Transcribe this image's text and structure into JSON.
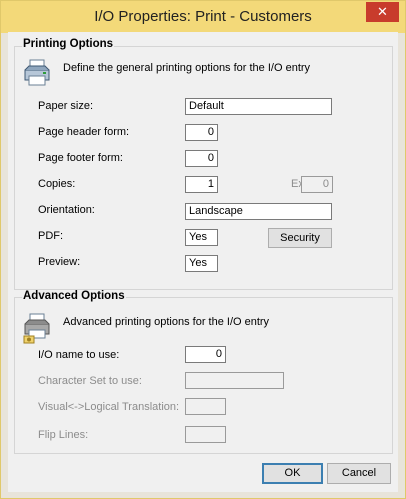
{
  "window": {
    "title": "I/O Properties: Print - Customers",
    "close_glyph": "✕",
    "colors": {
      "titlebar": "#f3d979",
      "close": "#c83c2c"
    }
  },
  "printing_options": {
    "title": "Printing Options",
    "description": "Define the general printing options for the I/O entry",
    "icon": "printer-icon",
    "paper_size": {
      "label": "Paper size:",
      "value": "Default"
    },
    "page_header_form": {
      "label": "Page header form:",
      "value": "0"
    },
    "page_footer_form": {
      "label": "Page footer form:",
      "value": "0"
    },
    "copies": {
      "label": "Copies:",
      "value": "1"
    },
    "exp": {
      "label": "Exp :",
      "value": "0"
    },
    "orientation": {
      "label": "Orientation:",
      "value": "Landscape"
    },
    "pdf": {
      "label": "PDF:",
      "value": "Yes"
    },
    "security_button": "Security",
    "preview": {
      "label": "Preview:",
      "value": "Yes"
    }
  },
  "advanced_options": {
    "title": "Advanced Options",
    "description": "Advanced printing options for the I/O entry",
    "icon": "printer-settings-icon",
    "io_name": {
      "label": "I/O name to use:",
      "value": "0"
    },
    "character_set": {
      "label": "Character Set to use:",
      "value": ""
    },
    "visual_logical": {
      "label": "Visual<->Logical Translation:",
      "value": ""
    },
    "flip_lines": {
      "label": "Flip Lines:",
      "value": ""
    }
  },
  "footer": {
    "ok_label": "OK",
    "cancel_label": "Cancel"
  }
}
